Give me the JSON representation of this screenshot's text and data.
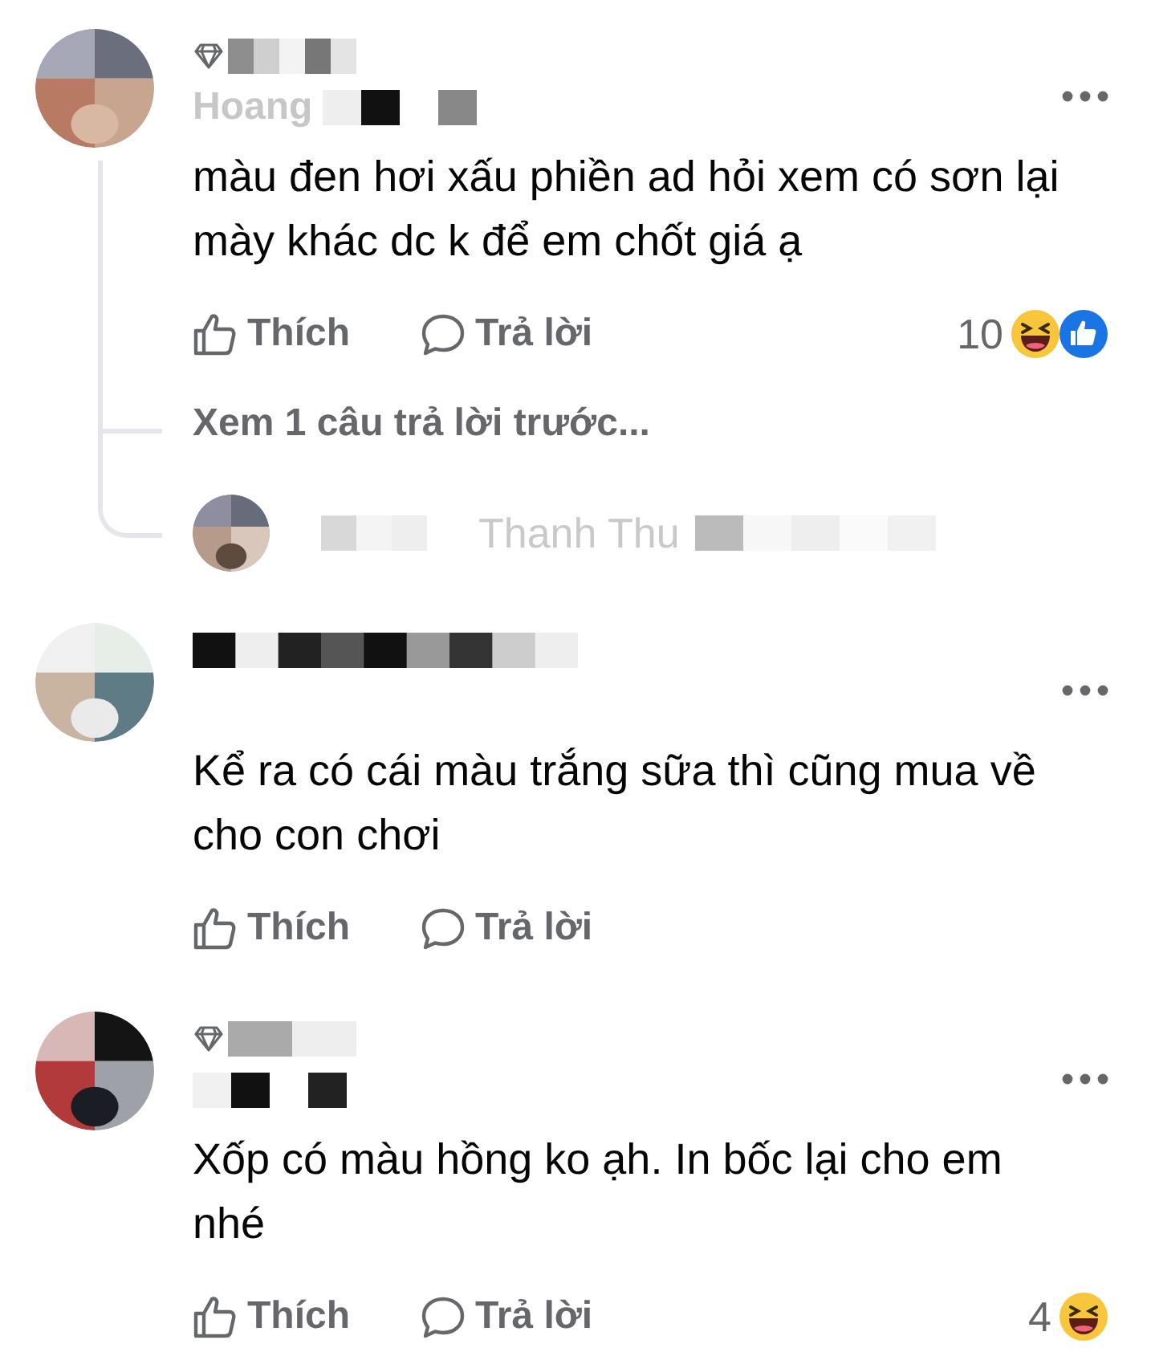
{
  "comments": [
    {
      "badge": true,
      "name": "Hoang",
      "text": "màu đen hơi xấu phiền ad hỏi xem có sơn lại mày khác dc k để em chốt giá ạ",
      "actions": [
        "Thích",
        "Trả lời"
      ],
      "reaction_count": "10",
      "reactions": [
        {
          "kind": "haha"
        },
        {
          "kind": "like"
        }
      ],
      "view_replies": "Xem 1 câu trả lời trước...",
      "reply_preview": {
        "name": "Thanh Thu"
      }
    },
    {
      "badge": false,
      "text": "Kể ra có cái màu trắng sữa thì cũng mua về cho con chơi",
      "actions": [
        "Thích",
        "Trả lời"
      ]
    },
    {
      "badge": true,
      "text": "Xốp có màu hồng ko ạh. In bốc lại cho em nhé",
      "actions": [
        "Thích",
        "Trả lời"
      ],
      "reaction_count": "4",
      "reactions": [
        {
          "kind": "haha"
        }
      ]
    }
  ]
}
